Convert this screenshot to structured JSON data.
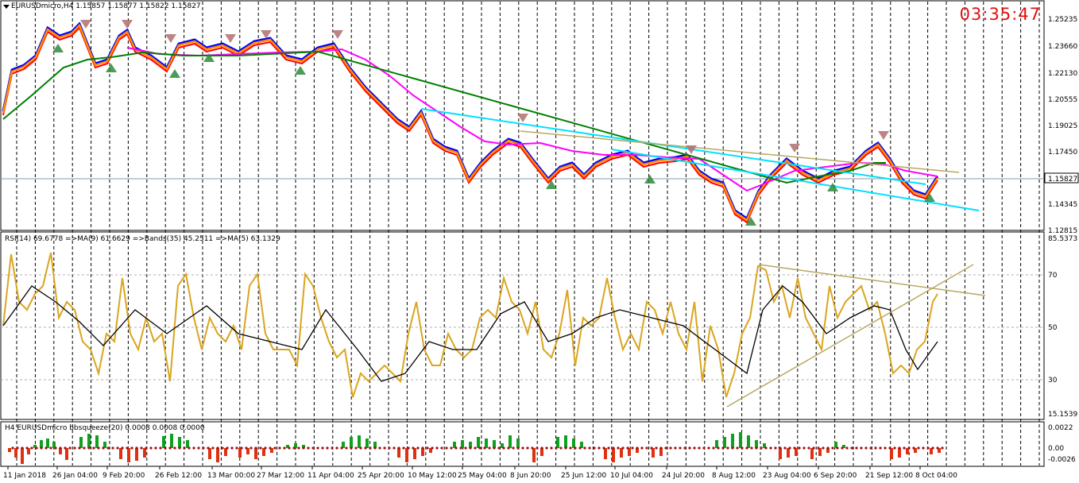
{
  "main": {
    "title": "EURUSDmicro,H4  1.15857 1.15877 1.15822 1.15827",
    "clock": "03:35:47",
    "price_labels": [
      "1.25235",
      "1.23660",
      "1.22130",
      "1.20555",
      "1.19025",
      "1.17450",
      "1.15827",
      "1.14345",
      "1.12815"
    ],
    "current_price": "1.15827",
    "colors": {
      "ma_fast": "#ff8c00",
      "ma_mid": "#ff00ff",
      "ma_slow": "#008000",
      "trendline": "#00e0ff",
      "resistance": "#b8a860",
      "up": "#0000ff",
      "down": "#ff0000"
    }
  },
  "rsi": {
    "title": "RSI(14) 69.6778  =>MA(9) 61.6629  =>Bands(35) 45.2511  =>MA(5) 63.1329",
    "levels": [
      "85.5373",
      "70",
      "50",
      "30",
      "15.1539"
    ],
    "colors": {
      "rsi": "#daa520",
      "signal": "#000000"
    }
  },
  "squeeze": {
    "title": "H4 EURUSDmicro bbsqueeze(20) 0.0008 0.0008 0.0000",
    "levels": [
      "0.0022",
      "0.00",
      "-0.0026"
    ]
  },
  "time_axis": [
    "11 Jan 2018",
    "26 Jan 04:00",
    "9 Feb 20:00",
    "26 Feb 12:00",
    "13 Mar 00:00",
    "27 Mar 12:00",
    "11 Apr 04:00",
    "25 Apr 20:00",
    "10 May 12:00",
    "25 May 04:00",
    "8 Jun 20:00",
    "25 Jun 12:00",
    "10 Jul 04:00",
    "24 Jul 20:00",
    "8 Aug 12:00",
    "23 Aug 04:00",
    "6 Sep 20:00",
    "21 Sep 12:00",
    "8 Oct 04:00"
  ]
}
